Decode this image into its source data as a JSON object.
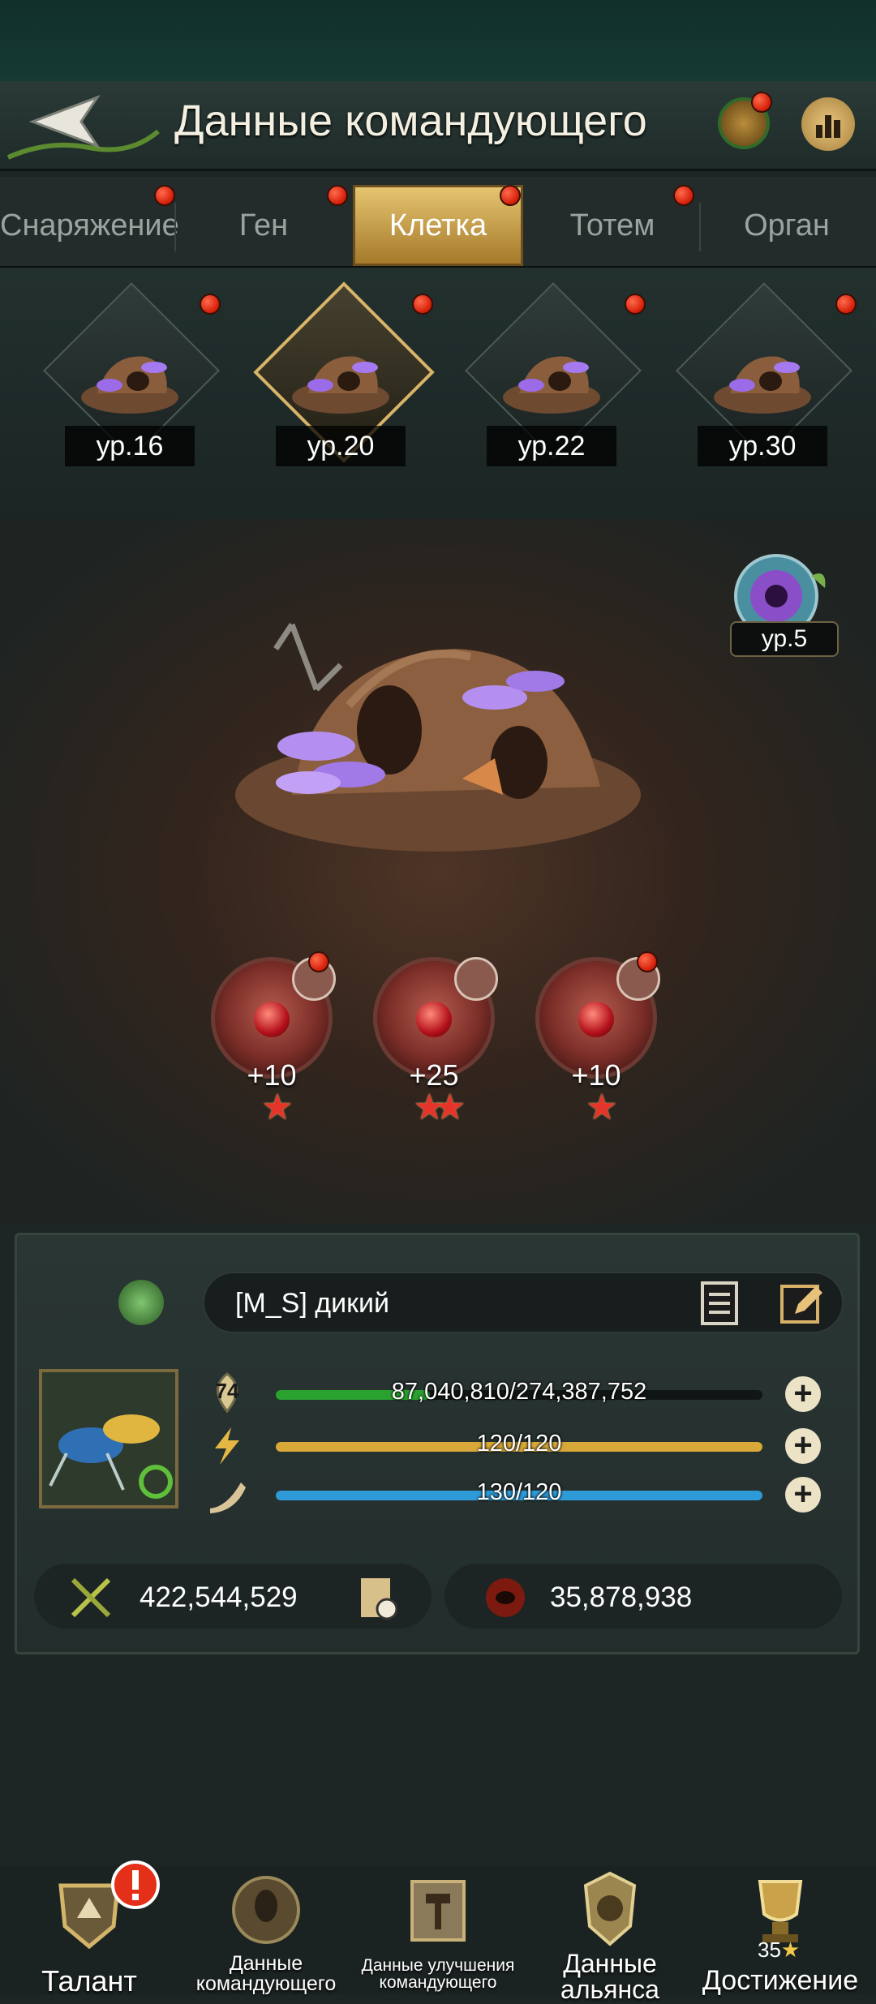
{
  "header": {
    "title": "Данные командующего"
  },
  "tabs": [
    {
      "label": "Снаряжение",
      "active": false,
      "notify": true
    },
    {
      "label": "Ген",
      "active": false,
      "notify": true
    },
    {
      "label": "Клетка",
      "active": true,
      "notify": true
    },
    {
      "label": "Тотем",
      "active": false,
      "notify": true
    },
    {
      "label": "Орган",
      "active": false,
      "notify": false
    }
  ],
  "cages": [
    {
      "level": "ур.16"
    },
    {
      "level": "ур.20"
    },
    {
      "level": "ур.22"
    },
    {
      "level": "ур.30"
    }
  ],
  "upgrade_orb": {
    "level": "ур.5"
  },
  "slots": [
    {
      "bonus": "+10",
      "stars": 1
    },
    {
      "bonus": "+25",
      "stars": 2
    },
    {
      "bonus": "+10",
      "stars": 1
    }
  ],
  "commander": {
    "name": "[M_S] дикий"
  },
  "bars": [
    {
      "label": "74",
      "text": "87,040,810/274,387,752",
      "fill": 0.317,
      "color": "#2aa22f"
    },
    {
      "label": "",
      "text": "120/120",
      "fill": 1.0,
      "color": "#d8a938"
    },
    {
      "label": "",
      "text": "130/120",
      "fill": 1.0,
      "color": "#2e9ad8"
    }
  ],
  "stats": {
    "power": "422,544,529",
    "kills": "35,878,938"
  },
  "bottom_nav": [
    {
      "label": "Талант"
    },
    {
      "label": "Данные командующего"
    },
    {
      "label": "Данные улучшения командующего"
    },
    {
      "label": "Данные альянса"
    },
    {
      "label": "Достижение",
      "count": "35"
    }
  ],
  "colors": {
    "accent_gold": "#d7b467",
    "notify_red": "#e0301e"
  }
}
